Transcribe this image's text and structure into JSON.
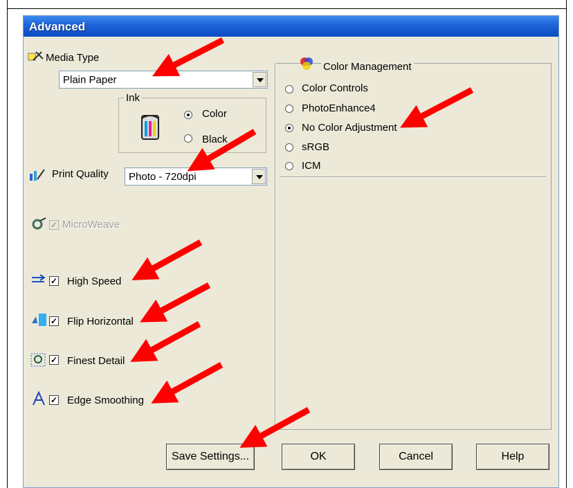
{
  "dialog": {
    "title": "Advanced"
  },
  "media_type": {
    "label": "Media Type",
    "value": "Plain Paper"
  },
  "ink": {
    "group_label": "Ink",
    "options": [
      "Color",
      "Black"
    ],
    "selected": "Color"
  },
  "print_quality": {
    "label": "Print Quality",
    "value": "Photo - 720dpi"
  },
  "options": {
    "microweave": {
      "label": "MicroWeave",
      "checked": true,
      "disabled": true
    },
    "high_speed": {
      "label": "High Speed",
      "checked": true
    },
    "flip_horizontal": {
      "label": "Flip Horizontal",
      "checked": true
    },
    "finest_detail": {
      "label": "Finest Detail",
      "checked": true
    },
    "edge_smoothing": {
      "label": "Edge Smoothing",
      "checked": true
    }
  },
  "color_management": {
    "group_label": "Color Management",
    "options": [
      "Color Controls",
      "PhotoEnhance4",
      "No Color Adjustment",
      "sRGB",
      "ICM"
    ],
    "selected": "No Color Adjustment"
  },
  "buttons": {
    "save": "Save Settings...",
    "ok": "OK",
    "cancel": "Cancel",
    "help": "Help"
  },
  "annotations": {
    "arrow_color": "#ff0000"
  },
  "colors": {
    "titlebar": "#0a4bc4",
    "dialog_bg": "#ece9d8"
  }
}
